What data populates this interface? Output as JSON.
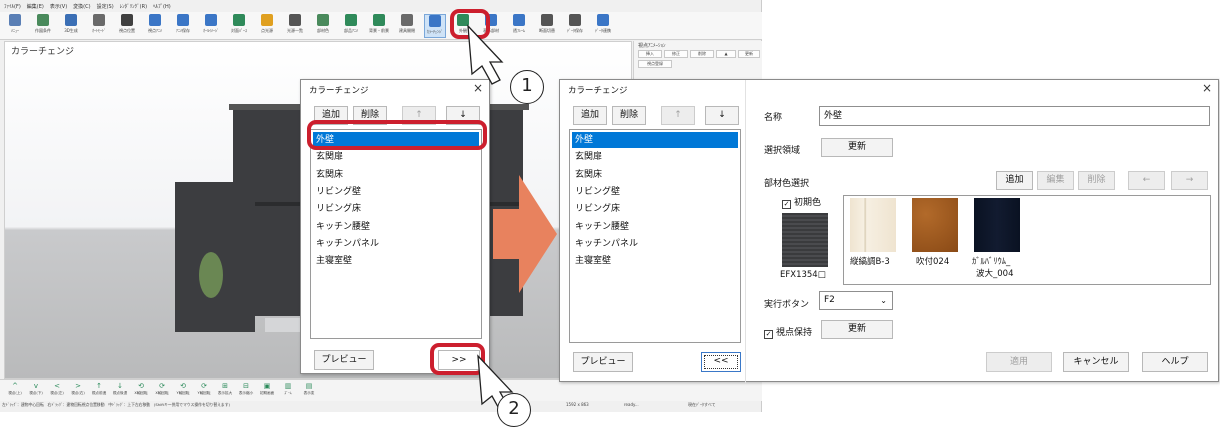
{
  "menubar": [
    "ﾌｧｲﾙ(F)",
    "編集(E)",
    "表示(V)",
    "変換(C)",
    "設定(S)",
    "ﾚﾝﾀﾞﾘﾝｸﾞ(R)",
    "ﾍﾙﾌﾟ(H)"
  ],
  "toolbar": {
    "items": [
      "ﾒﾆｭｰ",
      "作図条件",
      "3D生成",
      "ｵｰﾄﾓｰﾄﾞ",
      "視点位置",
      "視点ｱﾆﾒ",
      "ｱﾆﾒ保存",
      "ｵｰﾙｲﾒｰｼﾞ",
      "対面ﾊﾟｰｽ",
      "点光源",
      "光源一覧",
      "部材色",
      "部品ｱﾆﾒ",
      "背景・前景",
      "建具開閉",
      "ｶﾗｰﾁｪﾝｼﾞ",
      "外観",
      "表示部材",
      "透ﾌﾚｰﾑ",
      "断面切替",
      "ﾃﾞｰﾀ保存",
      "ﾃﾞｰﾀ連携"
    ]
  },
  "viewport": {
    "title": "カラーチェンジ"
  },
  "right_panel": {
    "title": "視点ｱﾆﾒｰｼｮﾝ",
    "buttons": [
      "挿入",
      "修正",
      "削除",
      "▲",
      "更新",
      "視点登録"
    ]
  },
  "navbar": {
    "items": [
      {
        "arrow": "^",
        "label": "視点(上)"
      },
      {
        "arrow": "v",
        "label": "視点(下)"
      },
      {
        "arrow": "<",
        "label": "視点(左)"
      },
      {
        "arrow": ">",
        "label": "視点(右)"
      },
      {
        "arrow": "↑",
        "label": "視点前進"
      },
      {
        "arrow": "↓",
        "label": "視点後退"
      },
      {
        "arrow": "⟲",
        "label": "X軸回転"
      },
      {
        "arrow": "⟳",
        "label": "X軸回転"
      },
      {
        "arrow": "⟲",
        "label": "Y軸回転"
      },
      {
        "arrow": "⟳",
        "label": "Y軸回転"
      },
      {
        "arrow": "⊞",
        "label": "表示拡大"
      },
      {
        "arrow": "⊟",
        "label": "表示縮小"
      },
      {
        "arrow": "▣",
        "label": "初期画面"
      },
      {
        "arrow": "▥",
        "label": "ｽﾞｰﾑ"
      },
      {
        "arrow": "▤",
        "label": "表示変"
      }
    ],
    "hint": "左ﾄﾞﾗｯｸﾞ：建物中心回転　右ﾄﾞﾗｯｸﾞ：建物回転視点位置移動　中ﾄﾞﾗｯｸﾞ：上下左右移動　(Shiftキー併用でマウス操作を切り替えます)"
  },
  "statusbar": {
    "size": "1592 x 863",
    "state": "ready...",
    "mode": "現在ﾃﾞｰﾀすべて"
  },
  "dialog_small": {
    "title": "カラーチェンジ",
    "close": "×",
    "add": "追加",
    "delete": "削除",
    "up": "↑",
    "down": "↓",
    "items": [
      "外壁",
      "玄関扉",
      "玄関床",
      "リビング壁",
      "リビング床",
      "キッチン腰壁",
      "キッチンパネル",
      "主寝室壁"
    ],
    "selected_index": 0,
    "preview": "プレビュー",
    "expand": ">>"
  },
  "dialog_large": {
    "title": "カラーチェンジ",
    "close": "×",
    "add": "追加",
    "delete": "削除",
    "up": "↑",
    "down": "↓",
    "items": [
      "外壁",
      "玄関扉",
      "玄関床",
      "リビング壁",
      "リビング床",
      "キッチン腰壁",
      "キッチンパネル",
      "主寝室壁"
    ],
    "selected_index": 0,
    "preview": "プレビュー",
    "collapse": "<<",
    "name_label": "名称",
    "name_value": "外壁",
    "area_label": "選択領域",
    "area_update": "更新",
    "material_label": "部材色選択",
    "material_buttons": {
      "add": "追加",
      "edit": "編集",
      "delete": "削除",
      "left": "←",
      "right": "→"
    },
    "initial_color_label": "初期色",
    "initial_color_checked": true,
    "initial_swatch_name": "EFX1354□",
    "swatches": [
      {
        "name": "縦縞調B-3",
        "color": "#f0e6d4"
      },
      {
        "name": "吹付024",
        "color": "#9c5a1e"
      },
      {
        "name": "ｶﾞﾙﾊﾞﾘｳﾑ_\n波大_004",
        "name_line1": "ｶﾞﾙﾊﾞﾘｳﾑ_",
        "name_line2": "波大_004",
        "color": "#0c1426"
      }
    ],
    "exec_label": "実行ボタン",
    "exec_value": "F2",
    "keep_view_label": "視点保持",
    "keep_view_checked": true,
    "keep_view_update": "更新",
    "apply": "適用",
    "cancel": "キャンセル",
    "help": "ヘルプ"
  },
  "annotations": {
    "step1": "1",
    "step2": "2"
  },
  "colors": {
    "selection": "#0078d7",
    "callout": "#cc1f2e",
    "arrow": "#e8825e"
  }
}
